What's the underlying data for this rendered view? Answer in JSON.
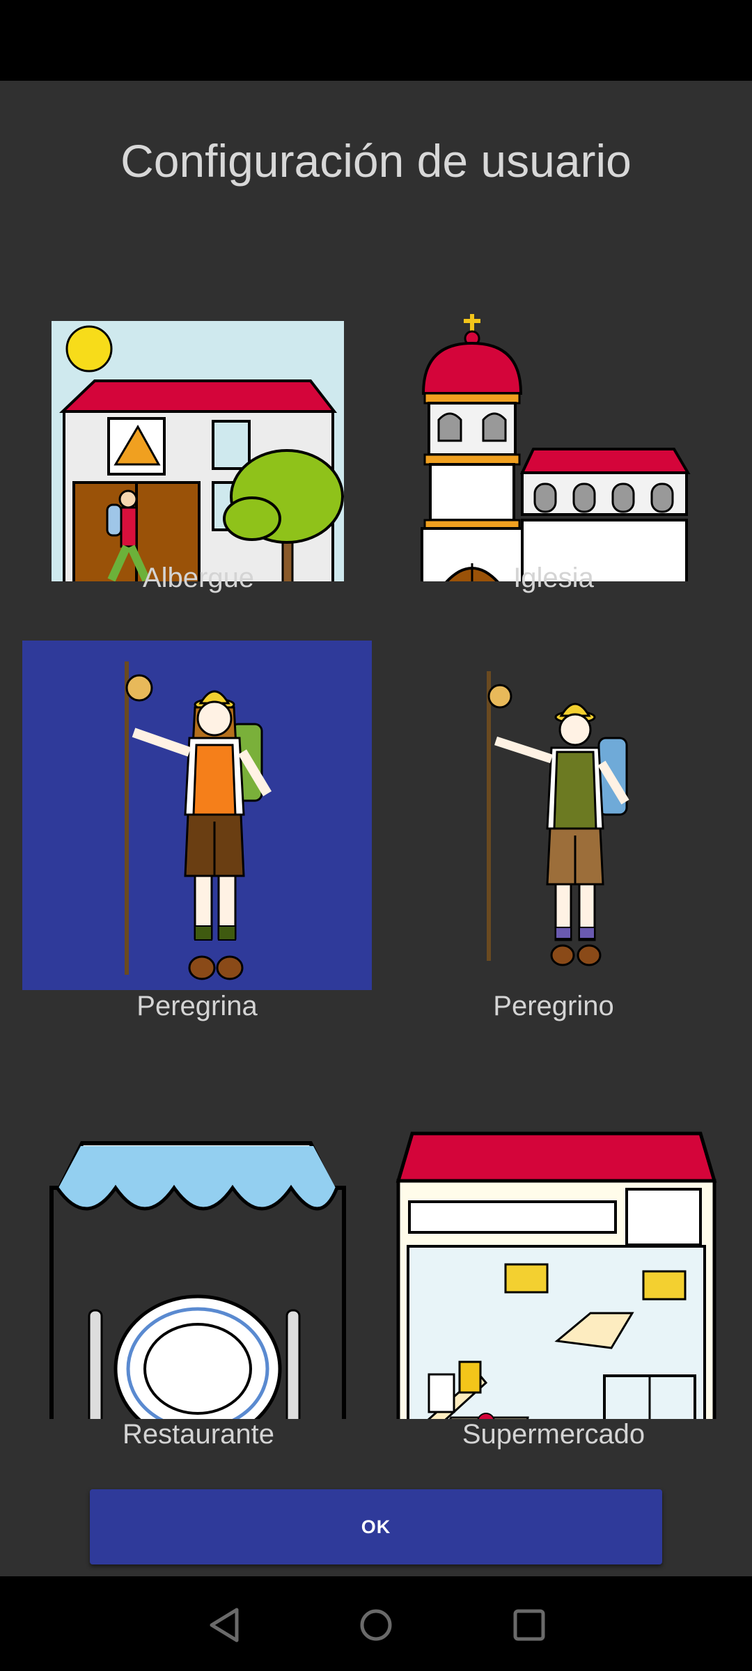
{
  "dialog": {
    "title": "Configuración de usuario",
    "ok_label": "OK"
  },
  "options": [
    {
      "label": "Albergue",
      "icon": "hostel-icon",
      "selected": false
    },
    {
      "label": "Iglesia",
      "icon": "church-icon",
      "selected": false
    },
    {
      "label": "Peregrina",
      "icon": "female-pilgrim-icon",
      "selected": true
    },
    {
      "label": "Peregrino",
      "icon": "male-pilgrim-icon",
      "selected": false
    },
    {
      "label": "Restaurante",
      "icon": "restaurant-icon",
      "selected": false
    },
    {
      "label": "Supermercado",
      "icon": "supermarket-icon",
      "selected": false
    }
  ],
  "navigation": {
    "buttons": [
      "back-icon",
      "home-icon",
      "recents-icon"
    ]
  },
  "colors": {
    "background": "#303030",
    "accent": "#2f3a9a",
    "text": "#d4d4d4"
  }
}
